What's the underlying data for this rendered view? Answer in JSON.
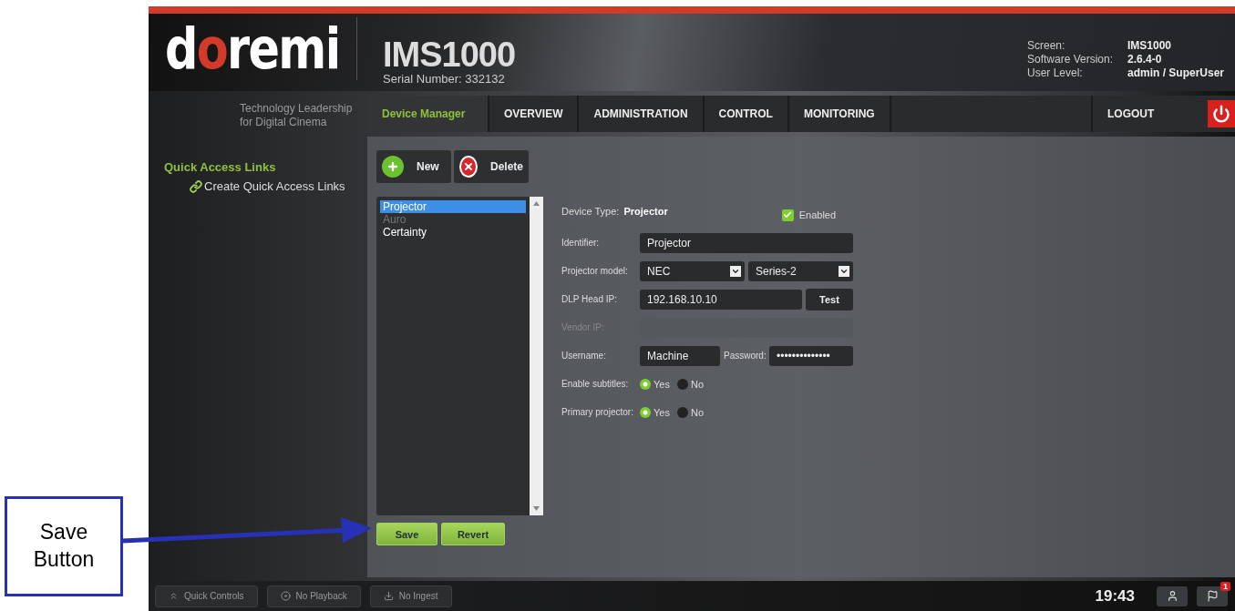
{
  "logo": {
    "text": "doremi",
    "tagline": [
      "Technology Leadership",
      "for Digital Cinema"
    ]
  },
  "device": {
    "title": "IMS1000",
    "serial": "Serial Number: 332132"
  },
  "info": [
    {
      "label": "Screen:",
      "value": "IMS1000"
    },
    {
      "label": "Software Version:",
      "value": "2.6.4-0"
    },
    {
      "label": "User Level:",
      "value": "admin / SuperUser"
    }
  ],
  "nav": {
    "tabs": [
      {
        "label": "Device Manager",
        "selected": true
      },
      {
        "label": "OVERVIEW",
        "selected": false
      },
      {
        "label": "ADMINISTRATION",
        "selected": false
      },
      {
        "label": "CONTROL",
        "selected": false
      },
      {
        "label": "MONITORING",
        "selected": false
      }
    ],
    "logout": "LOGOUT"
  },
  "sidebar": {
    "title": "Quick Access Links",
    "links": [
      "Create Quick Access Links"
    ]
  },
  "toolbar": [
    {
      "kind": "add",
      "label": "New"
    },
    {
      "kind": "delete",
      "label": "Delete"
    }
  ],
  "devices": [
    {
      "label": "Projector",
      "selected": true,
      "disabled": false
    },
    {
      "label": "Auro",
      "selected": false,
      "disabled": true
    },
    {
      "label": "Certainty",
      "selected": false,
      "disabled": false
    }
  ],
  "form": {
    "device_type_label": "Device Type:",
    "device_type": "Projector",
    "enabled": {
      "label": "Enabled",
      "checked": true
    },
    "rows": [
      {
        "kind": "text",
        "label": "Identifier:",
        "value": "Projector",
        "disabled": false
      },
      {
        "kind": "selects",
        "label": "Projector model:",
        "values": [
          "NEC",
          "Series-2"
        ]
      },
      {
        "kind": "text-button",
        "label": "DLP Head IP:",
        "value": "192.168.10.10",
        "button": "Test"
      },
      {
        "kind": "text",
        "label": "Vendor IP:",
        "disabled": true
      },
      {
        "kind": "credentials",
        "label": "Username:",
        "value": "Machine",
        "password_label": "Password:",
        "password": "••••••••••••••"
      },
      {
        "kind": "radio",
        "label": "Enable subtitles:",
        "options": [
          {
            "label": "Yes",
            "selected": true
          },
          {
            "label": "No",
            "selected": false
          }
        ]
      },
      {
        "kind": "radio",
        "label": "Primary projector:",
        "options": [
          {
            "label": "Yes",
            "selected": true
          },
          {
            "label": "No",
            "selected": false
          }
        ]
      }
    ]
  },
  "actions": [
    "Save",
    "Revert"
  ],
  "status_bar": {
    "buttons": [
      {
        "kind": "quick",
        "label": "Quick Controls"
      },
      {
        "kind": "playback",
        "label": "No Playback"
      },
      {
        "kind": "ingest",
        "label": "No Ingest"
      }
    ],
    "time": "19:43",
    "notifications": "1"
  },
  "callout": [
    "Save",
    "Button"
  ]
}
